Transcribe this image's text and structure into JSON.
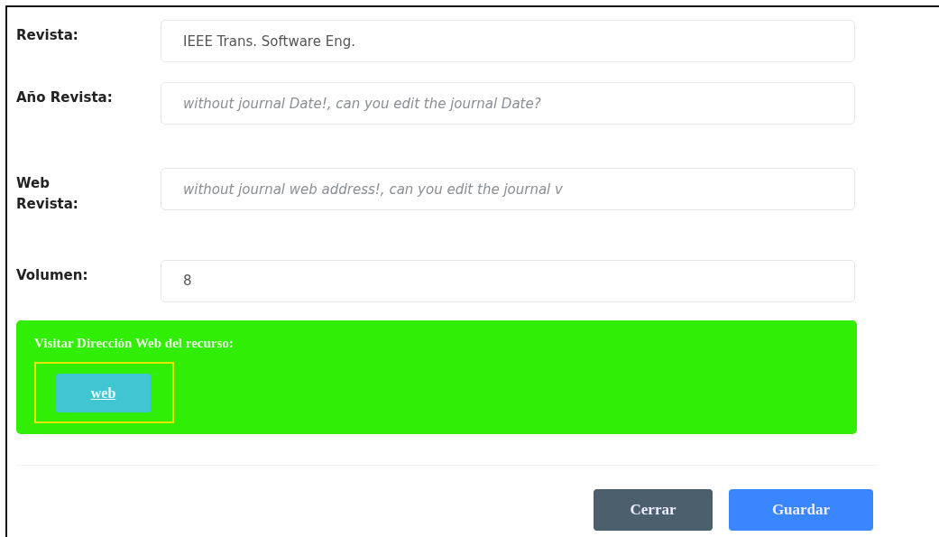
{
  "fields": [
    {
      "label": "Revista:",
      "value": "IEEE Trans. Software Eng."
    },
    {
      "label": "Año Revista:",
      "placeholder": "without journal Date!, can you edit the journal Date?"
    },
    {
      "label": "Web Revista:",
      "placeholder": "without journal web address!, can you edit the journal v"
    },
    {
      "label": "Volumen:",
      "value": "8"
    }
  ],
  "resource_panel": {
    "heading": "Visitar Dirección Web del recurso:",
    "button": {
      "label": "web",
      "highlighted": true
    }
  },
  "footer_buttons": [
    {
      "label": "Cerrar",
      "kind": "secondary"
    },
    {
      "label": "Guardar",
      "kind": "primary"
    }
  ]
}
